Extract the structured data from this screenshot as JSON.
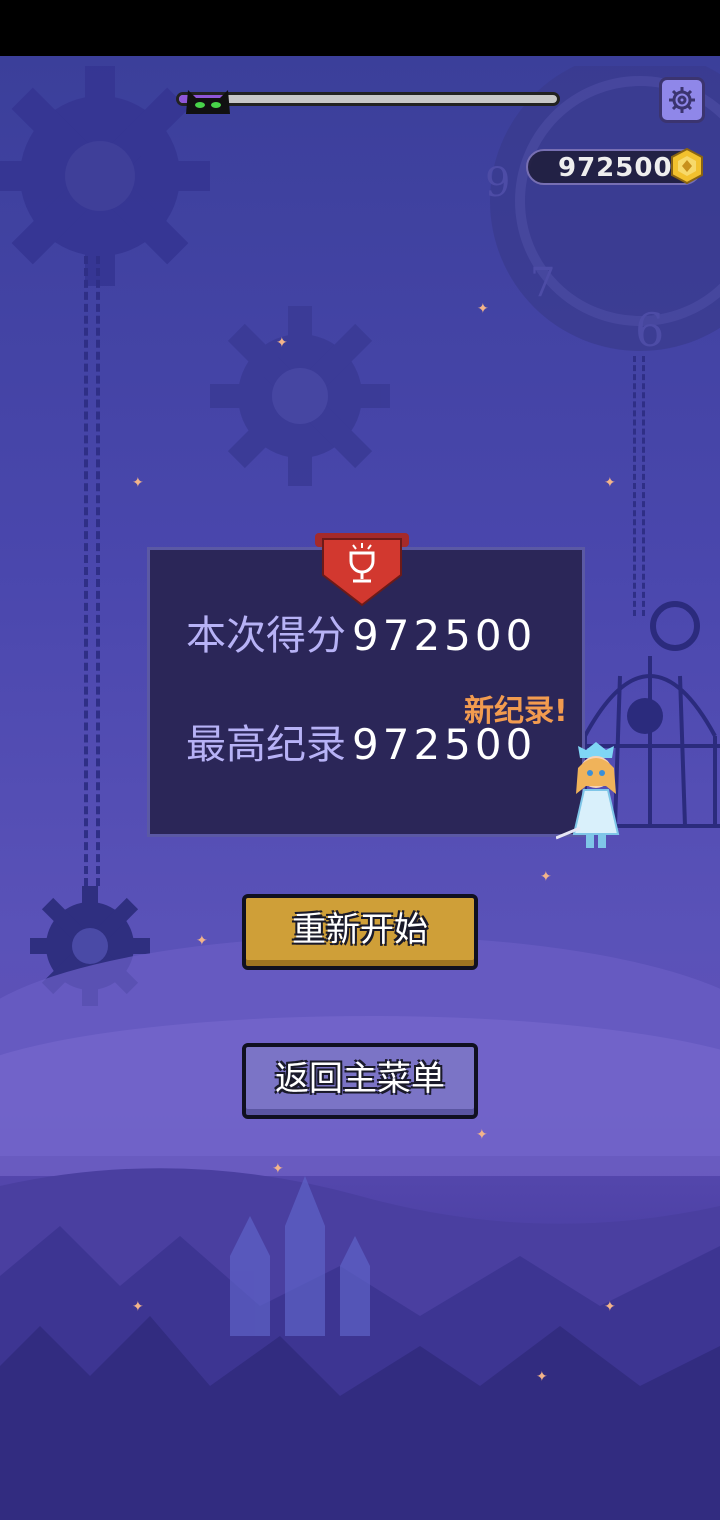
{
  "progress": {
    "fraction": 0.13
  },
  "coins": {
    "value": "972500"
  },
  "result": {
    "score_label": "本次得分",
    "score_value": "972500",
    "best_label": "最高纪录",
    "best_value": "972500",
    "new_record": "新纪录!"
  },
  "buttons": {
    "restart": "重新开始",
    "main_menu": "返回主菜单"
  },
  "colors": {
    "accent_gold": "#cf9f38",
    "accent_purple": "#7b74c6",
    "new_record": "#f29b4f"
  },
  "icons": [
    "cat-icon",
    "settings-gear-icon",
    "coin-icon",
    "trophy-icon"
  ]
}
